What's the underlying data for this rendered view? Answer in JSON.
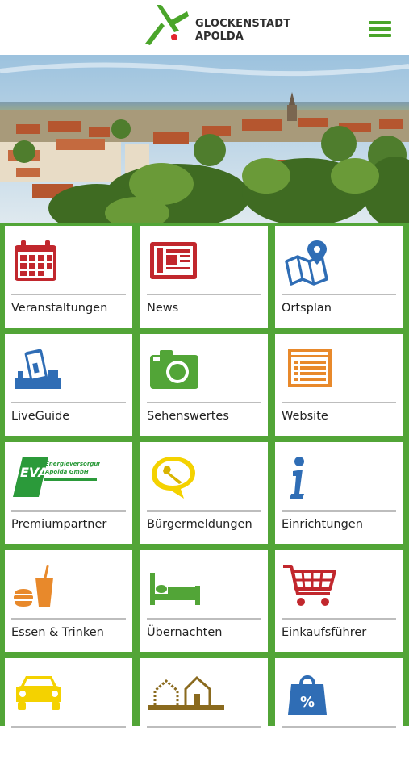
{
  "header": {
    "logo_line1": "GLOCKENSTADT",
    "logo_line2": "APOLDA",
    "brand_color": "#4aa52a",
    "menu_icon": "hamburger-menu-icon"
  },
  "hero": {
    "image": "town-panorama-image"
  },
  "tiles": [
    {
      "label": "Veranstaltungen",
      "icon": "calendar-icon",
      "color": "#c1272d"
    },
    {
      "label": "News",
      "icon": "newspaper-icon",
      "color": "#c1272d"
    },
    {
      "label": "Ortsplan",
      "icon": "map-pin-icon",
      "color": "#2f6db5"
    },
    {
      "label": "LiveGuide",
      "icon": "liveguide-icon",
      "color": "#2f6db5"
    },
    {
      "label": "Sehenswertes",
      "icon": "camera-icon",
      "color": "#52a537"
    },
    {
      "label": "Website",
      "icon": "website-icon",
      "color": "#e8892b"
    },
    {
      "label": "Premiumpartner",
      "icon": "eva-logo-icon",
      "color": "#2b9a3a",
      "logo_text": "EVA",
      "logo_sub1": "Energieversorgung",
      "logo_sub2": "Apolda GmbH"
    },
    {
      "label": "Bürgermeldungen",
      "icon": "wrench-bubble-icon",
      "color": "#e6c400"
    },
    {
      "label": "Einrichtungen",
      "icon": "info-icon",
      "color": "#2f6db5"
    },
    {
      "label": "Essen & Trinken",
      "icon": "food-drink-icon",
      "color": "#e8892b"
    },
    {
      "label": "Übernachten",
      "icon": "bed-icon",
      "color": "#52a537"
    },
    {
      "label": "Einkaufsführer",
      "icon": "shopping-cart-icon",
      "color": "#c1272d"
    },
    {
      "label": "",
      "icon": "car-icon",
      "color": "#e6c400"
    },
    {
      "label": "",
      "icon": "houses-icon",
      "color": "#8a6a1e"
    },
    {
      "label": "",
      "icon": "shopping-bag-icon",
      "color": "#2f6db5",
      "glyph": "%"
    }
  ]
}
